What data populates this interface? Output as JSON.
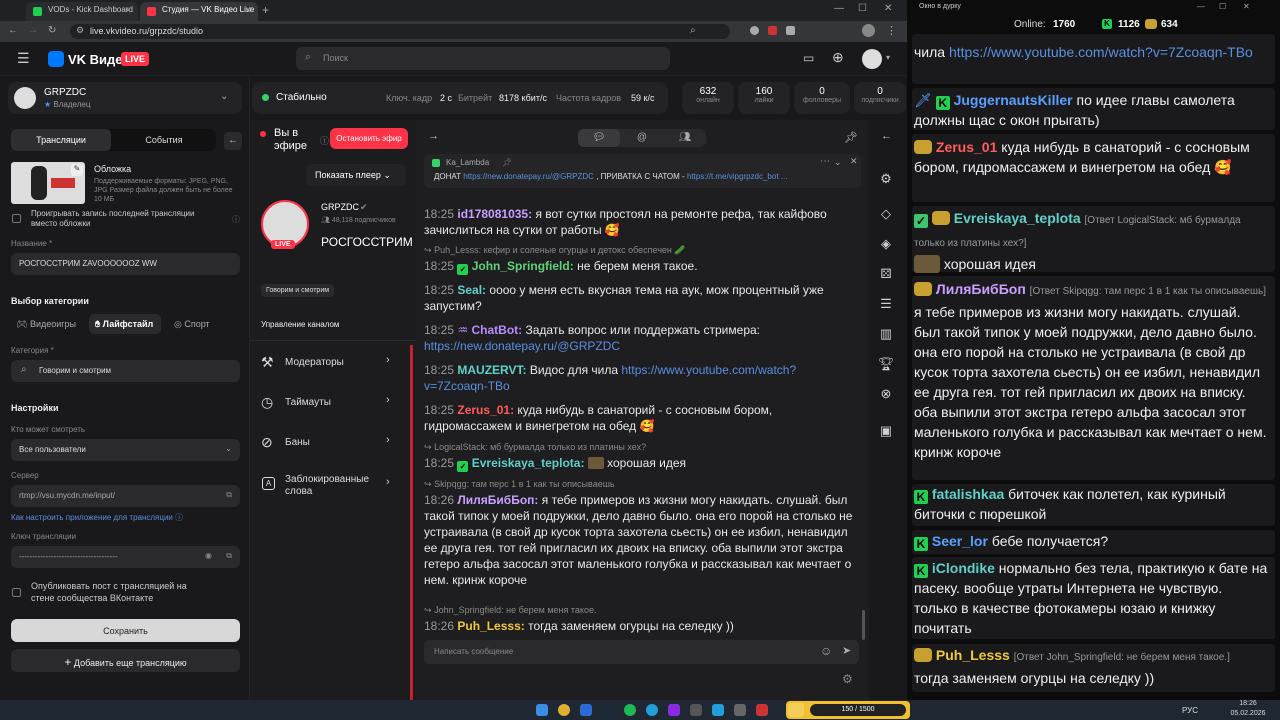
{
  "browser": {
    "tabs": [
      {
        "label": "VODs - Kick Dashboard"
      },
      {
        "label": "Студия — VK Видео Live"
      }
    ],
    "url": "live.vkvideo.ru/grpzdc/studio"
  },
  "header": {
    "logo": "VK Видео",
    "live_badge": "LIVE",
    "search_placeholder": "Поиск"
  },
  "left": {
    "channel_name": "GRPZDC",
    "channel_role": "Владелец",
    "tabs": [
      "Трансляции",
      "События"
    ],
    "cover_title": "Обложка",
    "cover_hint": "Поддерживаемые форматы: JPEG, PNG, JPG Размер файла должен быть не более 10 МБ",
    "play_last_label": "Проигрывать запись последней трансляции вместо обложки",
    "name_label": "Название *",
    "name_value": "РОСГОССТРИМ ZAVOOOOOOZ WW",
    "category_section": "Выбор категории",
    "category_tabs": [
      "Видеоигры",
      "Лайфстайл",
      "Спорт"
    ],
    "category_label": "Категория *",
    "category_value": "Говорим и смотрим",
    "settings_section": "Настройки",
    "who_label": "Кто может смотреть",
    "who_value": "Все пользователи",
    "server_label": "Сервер",
    "server_value": "rtmp://vsu.mycdn.me/input/",
    "setup_link": "Как настроить приложение для трансляции",
    "key_label": "Ключ трансляции",
    "key_value": "-------------------------------------",
    "publish_label": "Опубликовать пост с трансляцией на стене сообщества ВКонтакте",
    "save_button": "Сохранить",
    "add_button": "Добавить еще трансляцию"
  },
  "stats": {
    "status": "Стабильно",
    "keyframe_label": "Ключ. кадр",
    "keyframe_value": "2 с",
    "bitrate_label": "Битрейт",
    "bitrate_value": "8178 кбит/с",
    "fps_label": "Частота кадров",
    "fps_value": "59 к/с",
    "boxes": [
      {
        "value": "632",
        "label": "онлайн"
      },
      {
        "value": "160",
        "label": "лайки"
      },
      {
        "value": "0",
        "label": "фолловеры"
      },
      {
        "value": "0",
        "label": "подписчики"
      }
    ]
  },
  "center": {
    "on_air": "Вы в эфире",
    "stop_button": "Остановить эфир",
    "show_player": "Показать плеер",
    "channel": "GRPZDC",
    "subscribers": "48,118 подписчиков",
    "stream_title": "РОСГОССТРИМ ZAVOOOOOOZ WW",
    "category_chip": "Говорим и смотрим",
    "manage_title": "Управление каналом",
    "nav": [
      "Модераторы",
      "Таймауты",
      "Баны",
      "Заблокированные слова"
    ]
  },
  "chat": {
    "pinned_author": "Ka_Lambda",
    "pinned_text_a": "ДОНАТ",
    "pinned_link_a": "https://new.donatepay.ru/@GRPZDC",
    "pinned_text_b": ", ПРИВАТКА С ЧАТОМ -",
    "pinned_link_b": "https://t.me/vipgrpzdc_bot ...",
    "input_placeholder": "Написать сообщение",
    "msgs": [
      {
        "time": "18:25",
        "user": "id178081035:",
        "text": "я вот сутки простоял на ремонте рефа, так кайфово зачислиться на сутки от работы 🥰"
      },
      {
        "reply": "Puh_Lesss: кефир и соленые огурцы и детокс обеспечен 🥒",
        "time": "18:25",
        "user": "John_Springfield:",
        "text": "не берем меня такое."
      },
      {
        "time": "18:25",
        "user": "Seal:",
        "text": "оооо у меня есть вкусная тема на аук, мож процентный уже запустим?"
      },
      {
        "time": "18:25",
        "user": "ChatBot:",
        "text": "Задать вопрос или поддержать стримера:",
        "link": "https://new.donatepay.ru/@GRPZDC"
      },
      {
        "time": "18:25",
        "user": "MAUZERVT:",
        "text": "Видос для чила",
        "link": "https://www.youtube.com/watch?v=7Zcoaqn-TBo"
      },
      {
        "time": "18:25",
        "user": "Zerus_01:",
        "text": "куда нибудь в санаторий - с сосновым бором, гидромассажем и винегретом на обед 🥰"
      },
      {
        "reply": "LogicalStack: мб бурмалда только из платины хех?",
        "time": "18:25",
        "user": "Evreiskaya_teplota:",
        "text": "хорошая идея"
      },
      {
        "reply": "Skipqgg: там перс 1 в 1 как ты описываешь",
        "time": "18:26",
        "user": "ЛиляБибБоп:",
        "text": "я тебе примеров из жизни могу накидать. слушай. был такой типок у моей подружки, дело давно было. она его порой на столько не устраивала (в свой др кусок торта захотела сьесть) он ее избил, ненавидил ее друга гея. тот гей пригласил их двоих на вписку. оба выпили этот экстра гетеро альфа засосал этот маленького голубка и рассказывал как мечтает о нем. кринж короче"
      },
      {
        "reply": "John_Springfield: не берем меня такое.",
        "time": "18:26",
        "user": "Puh_Lesss:",
        "text": "тогда заменяем огурцы на селедку ))"
      }
    ]
  },
  "overlay": {
    "title": "Окно в дурку",
    "online_label": "Online:",
    "online_value": "1760",
    "kick_count": "1126",
    "vk_count": "634",
    "msgs": [
      {
        "user": "",
        "text": "чила",
        "link": "https://www.youtube.com/watch?v=7Zcoaqn-TBo"
      },
      {
        "user": "JuggernautsKiller",
        "text": "по идее главы самолета должны щас с окон прыгать)"
      },
      {
        "user": "Zerus_01",
        "text": "куда нибудь в санаторий - с сосновым бором, гидромассажем и винегретом на обед 🥰"
      },
      {
        "user": "Evreiskaya_teplota",
        "reply": "[Ответ LogicalStack: мб бурмалда только из платины хех?]",
        "text": "хорошая идея"
      },
      {
        "user": "ЛиляБибБоп",
        "reply": "[Ответ Skipqgg: там перс 1 в 1 как ты описываешь]",
        "text": "я тебе примеров из жизни могу накидать. слушай. был такой типок у моей подружки, дело давно было. она его порой на столько не устраивала (в свой др кусок торта захотела сьесть) он ее избил, ненавидил ее друга гея. тот гей пригласил их двоих на вписку. оба выпили этот экстра гетеро альфа засосал этот маленького голубка и рассказывал как мечтает о нем. кринж короче"
      },
      {
        "user": "fatalishkaa",
        "text": "биточек как полетел, как куриный биточки с пюрешкой"
      },
      {
        "user": "Seer_lor",
        "text": "бебе получается?"
      },
      {
        "user": "iClondike",
        "text": "нормально без тела, практикую к бате на пасеку. вообще утраты Интернета не чувствую. только в качестве фотокамеры юзаю и книжку почитать"
      },
      {
        "user": "Puh_Lesss",
        "reply": "[Ответ John_Springfield: не берем меня такое.]",
        "text": "тогда заменяем огурцы на селедку ))"
      }
    ]
  },
  "taskbar": {
    "lang": "РУС",
    "time": "18:26",
    "date": "05.02.2026",
    "widget": "150 / 1500"
  },
  "colors": {
    "accent": "#ff3347",
    "vk_blue": "#0077ff",
    "kick_green": "#20d050",
    "link": "#5b8fe0"
  }
}
